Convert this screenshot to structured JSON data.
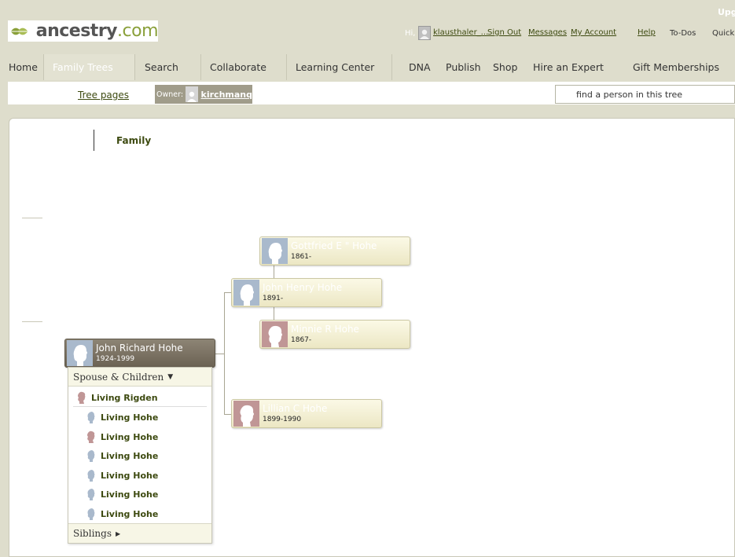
{
  "header": {
    "logo_main": "ancestry",
    "logo_suffix": ".com",
    "upgrade_text": "Upgrade",
    "greeting": "Hi,",
    "username": "klausthaler_...",
    "sign_out": "Sign Out",
    "messages": "Messages",
    "my_account": "My Account",
    "help": "Help",
    "todos": "To-Dos",
    "quick": "Quick"
  },
  "nav": {
    "home": "Home",
    "family_trees": "Family Trees",
    "search": "Search",
    "collaborate": "Collaborate",
    "learning_center": "Learning Center",
    "dna": "DNA",
    "publish": "Publish",
    "shop": "Shop",
    "hire_expert": "Hire an Expert",
    "gift_memberships": "Gift Memberships"
  },
  "subbar": {
    "tree_pages": "Tree pages",
    "owner_label": "Owner:",
    "owner_name": "kirchmanq",
    "search_placeholder": "find a person in this tree"
  },
  "tree": {
    "view_label": "Family",
    "focus": {
      "name": "John Richard Hohe",
      "dates": "1924-1999",
      "gender": "male"
    },
    "father": {
      "name": "John Henry Hohe",
      "dates": "1891-",
      "gender": "male"
    },
    "paternal_grandfather": {
      "name": "Gottfried E \" Hohe",
      "dates": "1861-",
      "gender": "male"
    },
    "paternal_grandmother": {
      "name": "Minnie R Hohe",
      "dates": "1867-",
      "gender": "female"
    },
    "mother": {
      "name": "Lillian C Hohe",
      "dates": "1899-1990",
      "gender": "female"
    }
  },
  "family_panel": {
    "spouse_children_label": "Spouse & Children",
    "spouse": {
      "name": "Living Rigden",
      "gender": "female"
    },
    "children": [
      {
        "name": "Living Hohe",
        "gender": "male"
      },
      {
        "name": "Living Hohe",
        "gender": "female"
      },
      {
        "name": "Living Hohe",
        "gender": "male"
      },
      {
        "name": "Living Hohe",
        "gender": "male"
      },
      {
        "name": "Living Hohe",
        "gender": "male"
      },
      {
        "name": "Living Hohe",
        "gender": "male"
      }
    ],
    "siblings_label": "Siblings"
  },
  "colors": {
    "background": "#deddcc",
    "link": "#3d4a10",
    "male_photo": "#a9b9cc",
    "female_photo": "#c09696",
    "focus_card": "#7a7262"
  }
}
